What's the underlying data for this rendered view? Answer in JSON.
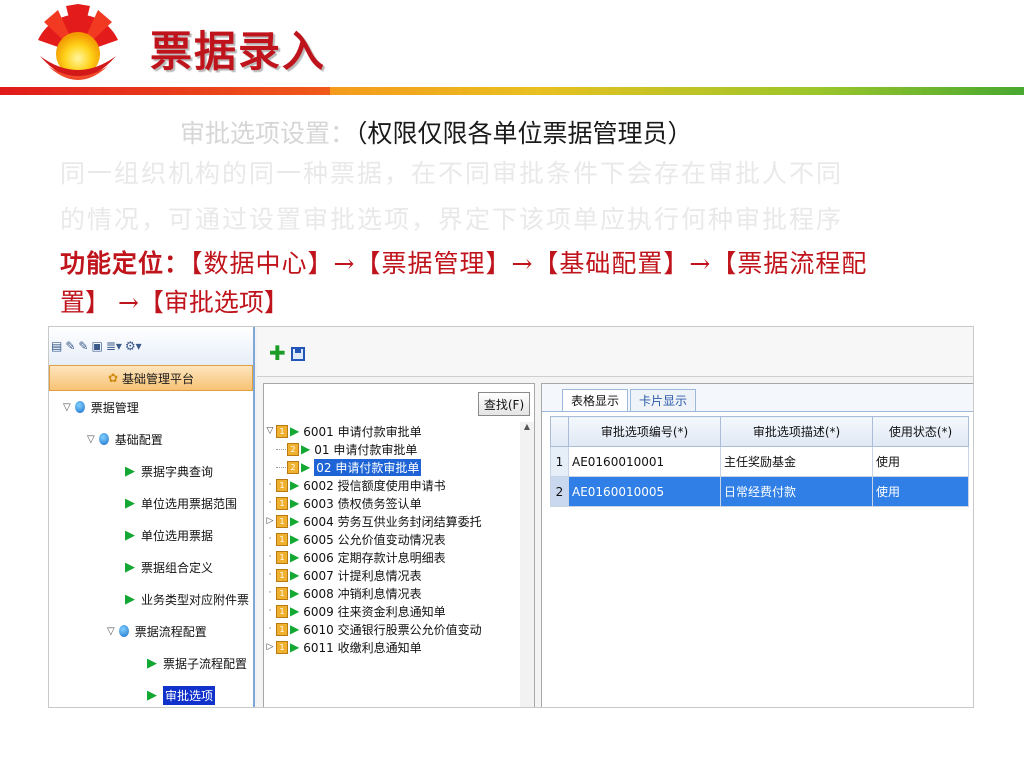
{
  "slide": {
    "title": "票据录入",
    "line1_main": "审批选项设置：",
    "line1_paren": "（权限仅限各单位票据管理员）",
    "line2_ghost": "同一组织机构的同一种票据，在不同审批条件下会存在审批人不同",
    "line3_ghost": "的情况，可通过设置审批选项，界定下该项单应执行何种审批程序",
    "func_label": "功能定位：",
    "func_path": "【数据中心】→【票据管理】→【基础配置】→【票据流程配",
    "func_path2": "置】 →【审批选项】"
  },
  "left_toolbar_icons": [
    "bookmark-icon",
    "edit-icon",
    "edit2-icon",
    "print-icon",
    "list-icon",
    "network-icon"
  ],
  "left_nav": {
    "platform": "基础管理平台",
    "items": [
      {
        "label": "票据管理",
        "level": 0,
        "kind": "folder"
      },
      {
        "label": "基础配置",
        "level": 1,
        "kind": "folder"
      },
      {
        "label": "票据字典查询",
        "level": 2,
        "kind": "leaf"
      },
      {
        "label": "单位选用票据范围",
        "level": 2,
        "kind": "leaf"
      },
      {
        "label": "单位选用票据",
        "level": 2,
        "kind": "leaf"
      },
      {
        "label": "票据组合定义",
        "level": 2,
        "kind": "leaf"
      },
      {
        "label": "业务类型对应附件票",
        "level": 2,
        "kind": "leaf"
      },
      {
        "label": "票据流程配置",
        "level": 1,
        "kind": "folder"
      },
      {
        "label": "票据子流程配置",
        "level": 3,
        "kind": "leaf"
      },
      {
        "label": "审批选项",
        "level": 3,
        "kind": "leaf",
        "selected": true
      }
    ]
  },
  "tree": {
    "find_button": "查找(F)",
    "items": [
      {
        "label": "6001 申请付款审批单",
        "expanded": true
      },
      {
        "label": "01 申请付款审批单",
        "child": true,
        "num": "2"
      },
      {
        "label": "02 申请付款审批单",
        "child": true,
        "num": "2",
        "selected": true
      },
      {
        "label": "6002 授信额度使用申请书"
      },
      {
        "label": "6003 债权债务签认单"
      },
      {
        "label": "6004 劳务互供业务封闭结算委托",
        "collapsed": true
      },
      {
        "label": "6005 公允价值变动情况表"
      },
      {
        "label": "6006 定期存款计息明细表"
      },
      {
        "label": "6007 计提利息情况表"
      },
      {
        "label": "6008 冲销利息情况表"
      },
      {
        "label": "6009 往来资金利息通知单"
      },
      {
        "label": "6010 交通银行股票公允价值变动"
      },
      {
        "label": "6011 收缴利息通知单"
      }
    ]
  },
  "grid": {
    "tabs": [
      "表格显示",
      "卡片显示"
    ],
    "columns": [
      "审批选项编号(*)",
      "审批选项描述(*)",
      "使用状态(*)"
    ],
    "rows": [
      {
        "n": "1",
        "code": "AE0160010001",
        "desc": "主任奖励基金",
        "status": "使用"
      },
      {
        "n": "2",
        "code": "AE0160010005",
        "desc": "日常经费付款",
        "status": "使用",
        "selected": true
      }
    ]
  },
  "colors": {
    "accent_red": "#c0141c",
    "selection_blue": "#2f7fe6"
  }
}
